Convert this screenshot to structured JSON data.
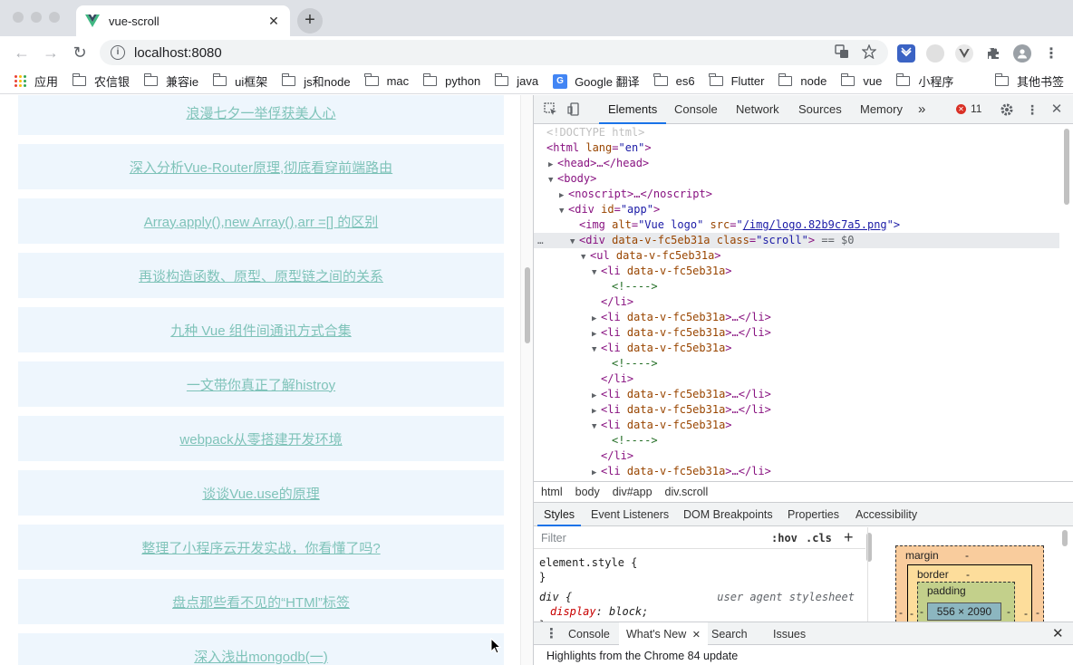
{
  "window": {
    "tab_title": "vue-scroll",
    "new_tab": "+",
    "close_tab": "✕"
  },
  "toolbar": {
    "back": "←",
    "forward": "→",
    "reload": "↻",
    "url": "localhost:8080",
    "info": "i"
  },
  "bookmarks": [
    {
      "label": "应用",
      "icon": "apps-grid-icon"
    },
    {
      "label": "农信银",
      "icon": "folder-icon"
    },
    {
      "label": "兼容ie",
      "icon": "folder-icon"
    },
    {
      "label": "ui框架",
      "icon": "folder-icon"
    },
    {
      "label": "js和node",
      "icon": "folder-icon"
    },
    {
      "label": "mac",
      "icon": "folder-icon"
    },
    {
      "label": "python",
      "icon": "folder-icon"
    },
    {
      "label": "java",
      "icon": "folder-icon"
    },
    {
      "label": "Google 翻译",
      "icon": "google-translate-icon"
    },
    {
      "label": "es6",
      "icon": "folder-icon"
    },
    {
      "label": "Flutter",
      "icon": "folder-icon"
    },
    {
      "label": "node",
      "icon": "folder-icon"
    },
    {
      "label": "vue",
      "icon": "folder-icon"
    },
    {
      "label": "小程序",
      "icon": "folder-icon"
    }
  ],
  "other_bookmarks": "其他书签",
  "page": {
    "items": [
      "浪漫七夕一举俘获美人心",
      "深入分析Vue-Router原理,彻底看穿前端路由",
      "Array.apply(),new Array(),arr =[] 的区别",
      "再谈构造函数、原型、原型链之间的关系",
      "九种 Vue 组件间通讯方式合集",
      "一文带你真正了解histroy",
      "webpack从零搭建开发环境",
      "谈谈Vue.use的原理",
      "整理了小程序云开发实战，你看懂了吗?",
      "盘点那些看不见的“HTMl”标签",
      "深入浅出mongodb(一)"
    ]
  },
  "devtools": {
    "tabs": [
      "Elements",
      "Console",
      "Network",
      "Sources",
      "Memory"
    ],
    "more": "»",
    "error_count": "11",
    "dom": {
      "doctype": "<!DOCTYPE html>",
      "l2_tag": "<html",
      "l2_attr": "lang",
      "l2_val": "\"en\"",
      "l2_end": ">",
      "l3": "<head>…</head>",
      "l4": "<body>",
      "l5": "<noscript>…</noscript>",
      "l6_tag": "<div",
      "l6_attr": "id",
      "l6_val": "\"app\"",
      "l6_end": ">",
      "l7_tag": "<img",
      "l7_attr1": "alt",
      "l7_val1": "\"Vue logo\"",
      "l7_attr2": "src",
      "l7_link": "/img/logo.82b9c7a5.png",
      "l7_end": "\">",
      "l8_tag": "<div",
      "l8_attr1": "data-v-fc5eb31a",
      "l8_attr2": "class",
      "l8_val": "\"scroll\"",
      "l8_end": ">",
      "l8_eq": "== $0",
      "ul_tag": "<ul",
      "li_open": "<li",
      "li_collapsed_end": ">…</li>",
      "gt": ">",
      "attr_v": "data-v-fc5eb31a",
      "comment": "<!---->",
      "li_close": "</li>",
      "dots": "…"
    },
    "breadcrumbs": [
      "html",
      "body",
      "div#app",
      "div.scroll"
    ],
    "subtabs": [
      "Styles",
      "Event Listeners",
      "DOM Breakpoints",
      "Properties",
      "Accessibility"
    ],
    "styles": {
      "filter_placeholder": "Filter",
      "hov": ":hov",
      "cls": ".cls",
      "add": "+",
      "element_style_open": "element.style {",
      "element_style_close": "}",
      "div_rule": "div {",
      "user_agent": "user agent stylesheet",
      "prop": "display",
      "value": ": block;",
      "close": "}"
    },
    "box_model": {
      "margin": "margin",
      "margin_val": "-",
      "border": "border",
      "border_val": "-",
      "padding": "padding",
      "content": "556 × 2090",
      "side": "-"
    },
    "drawer": {
      "tabs": [
        "Console",
        "What's New",
        "Search",
        "Issues"
      ],
      "content": "Highlights from the Chrome 84 update"
    }
  }
}
